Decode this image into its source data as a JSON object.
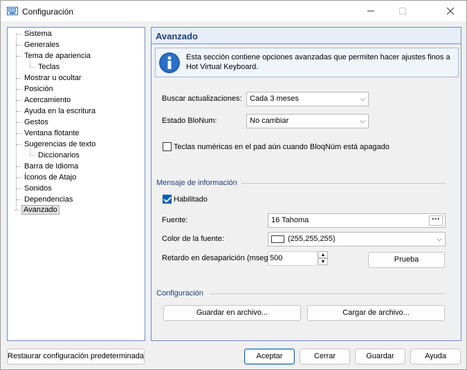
{
  "window": {
    "title": "Configuración"
  },
  "tree": {
    "items": [
      {
        "label": "Sistema"
      },
      {
        "label": "Generales"
      },
      {
        "label": "Tema de apariencia"
      },
      {
        "label": "Teclas"
      },
      {
        "label": "Mostrar u ocultar"
      },
      {
        "label": "Posición"
      },
      {
        "label": "Acercamiento"
      },
      {
        "label": "Ayuda en la escritura"
      },
      {
        "label": "Gestos"
      },
      {
        "label": "Ventana flotante"
      },
      {
        "label": "Sugerencias de texto"
      },
      {
        "label": "Diccionarios"
      },
      {
        "label": "Barra de Idioma"
      },
      {
        "label": "Íconos de Atajo"
      },
      {
        "label": "Sonidos"
      },
      {
        "label": "Dependencias"
      },
      {
        "label": "Avanzado"
      }
    ],
    "selected": "Avanzado"
  },
  "panel": {
    "header": "Avanzado",
    "info": "Esta sección contiene opciones avanzadas que permiten hacer ajustes finos a Hot Virtual Keyboard.",
    "updates": {
      "label": "Buscar actualizaciones:",
      "value": "Cada 3 meses"
    },
    "numlock": {
      "label": "Estado BloNum:",
      "value": "No cambiar"
    },
    "numpad_check": {
      "label": "Teclas numéricas en el pad aún cuando BloqNúm está apagado",
      "checked": false
    },
    "info_section": {
      "title": "Mensaje de información",
      "enabled": {
        "label": "Habilitado",
        "checked": true
      },
      "font": {
        "label": "Fuente:",
        "value": "16 Tahoma",
        "browse": "···"
      },
      "font_color": {
        "label": "Color de la fuente:",
        "value": "(255,255,255)",
        "swatch": "#ffffff"
      },
      "delay": {
        "label": "Retardo en desaparición (mseg)",
        "value": "500"
      },
      "test_button": "Prueba"
    },
    "config_section": {
      "title": "Configuración",
      "save_button": "Guardar en archivo...",
      "load_button": "Cargar de archivo..."
    }
  },
  "footer": {
    "restore_button": "Restaurar configuración predeterminada",
    "accept_button": "Aceptar",
    "cancel_button": "Cerrar",
    "save_button": "Guardar",
    "help_button": "Ayuda"
  },
  "colors": {
    "accent": "#005fb8",
    "header_text": "#1a3f7a",
    "border": "#6e8cc7"
  }
}
